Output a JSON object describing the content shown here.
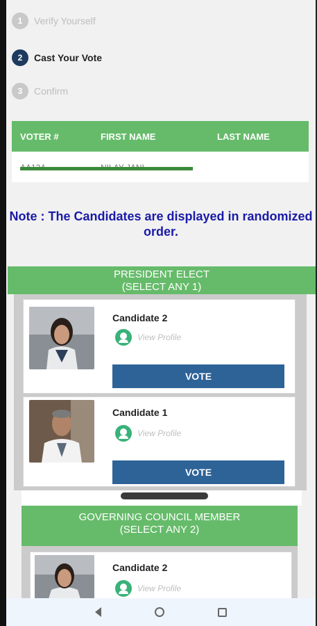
{
  "steps": [
    {
      "number": "1",
      "label": "Verify Yourself",
      "state": "inactive"
    },
    {
      "number": "2",
      "label": "Cast Your Vote",
      "state": "active"
    },
    {
      "number": "3",
      "label": "Confirm",
      "state": "inactive"
    }
  ],
  "voter_table": {
    "headers": [
      "VOTER #",
      "FIRST NAME",
      "LAST NAME"
    ],
    "row": [
      "AA124",
      "NILAY JANI",
      ""
    ]
  },
  "note": "Note : The Candidates are displayed in randomized order.",
  "sections": [
    {
      "title_line1": "PRESIDENT ELECT",
      "title_line2": "(SELECT ANY 1)",
      "candidates": [
        {
          "name": "Candidate 2",
          "view_profile": "View Profile",
          "vote_label": "VOTE"
        },
        {
          "name": "Candidate 1",
          "view_profile": "View Profile",
          "vote_label": "VOTE"
        }
      ]
    },
    {
      "title_line1": "GOVERNING COUNCIL MEMBER",
      "title_line2": "(SELECT ANY 2)",
      "candidates": [
        {
          "name": "Candidate 2",
          "view_profile": "View Profile"
        }
      ]
    }
  ],
  "colors": {
    "green_header": "#66bb6a",
    "vote_button": "#2e6398",
    "note_text": "#1a1aa8",
    "active_step": "#1e3a5f"
  }
}
